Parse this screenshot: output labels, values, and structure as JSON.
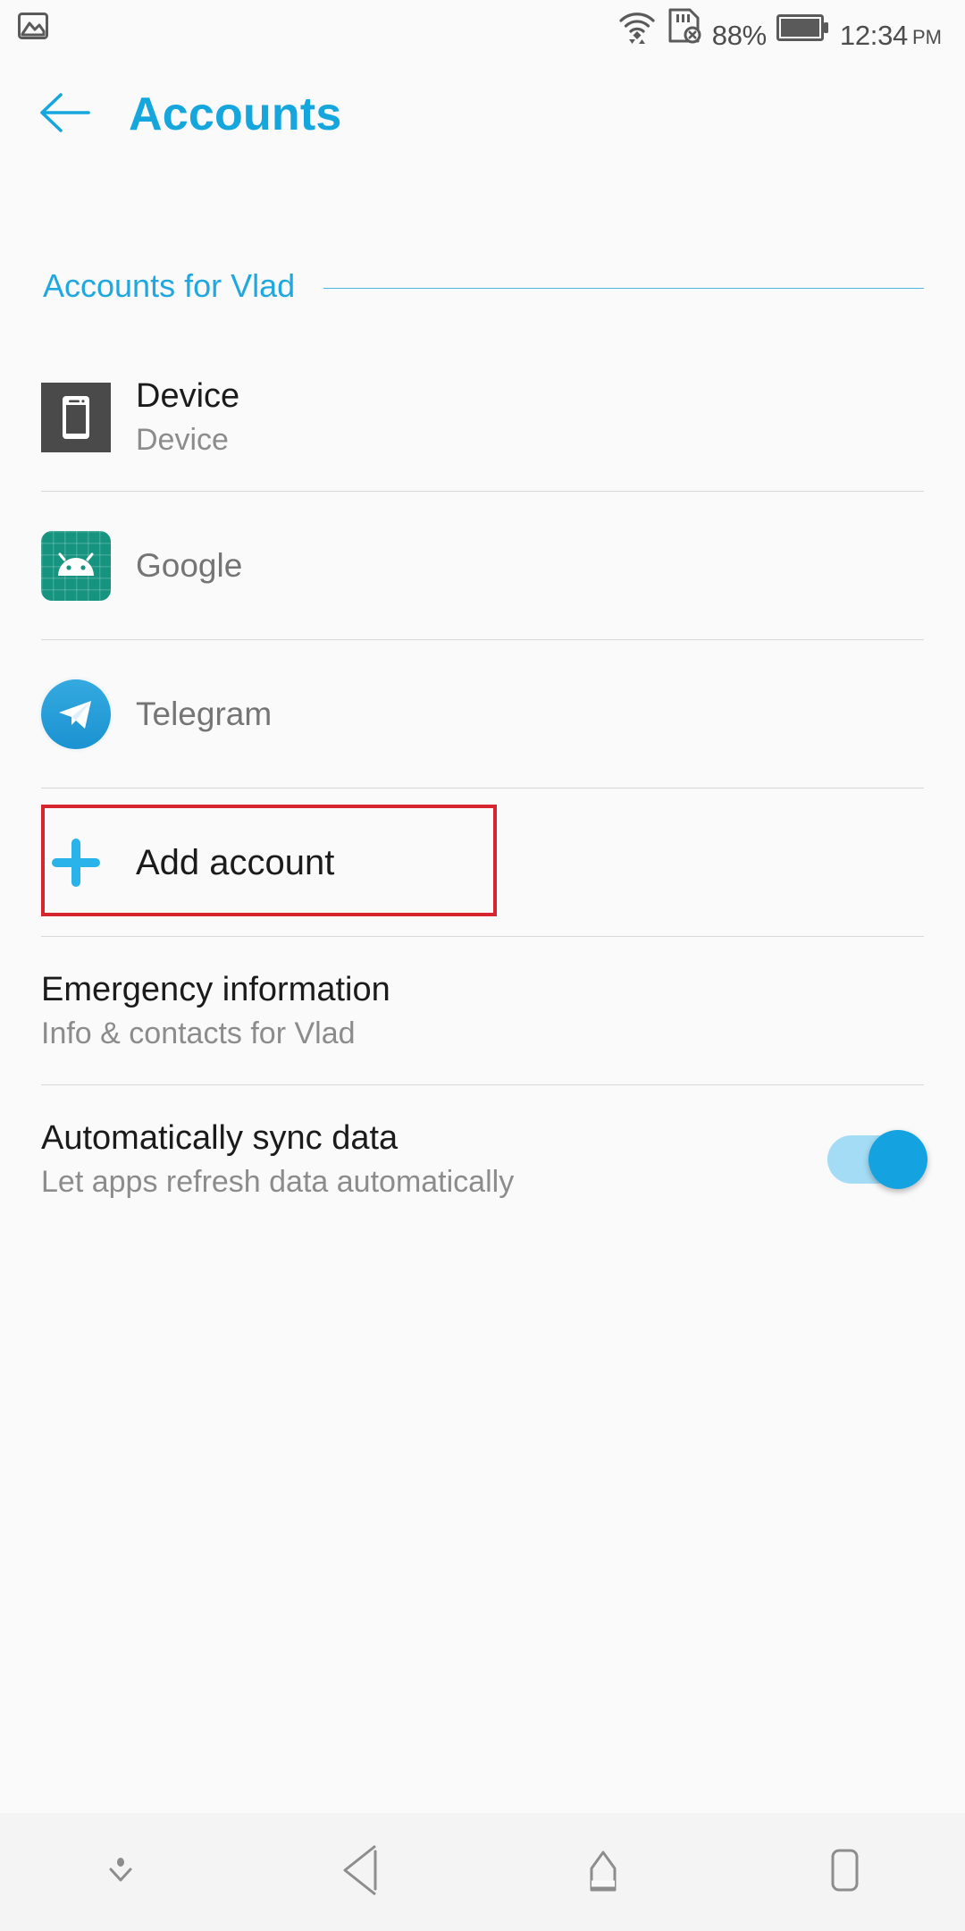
{
  "statusbar": {
    "notification_icon": "image-screenshot-icon",
    "wifi_icon": "wifi-icon",
    "sim_icon": "sim-card-no-service-icon",
    "battery_percent": "88%",
    "battery_icon": "battery-icon",
    "time": "12:34",
    "ampm": "PM"
  },
  "header": {
    "back_icon": "back-arrow-icon",
    "title": "Accounts",
    "accent_color": "#15a6dd"
  },
  "section": {
    "title": "Accounts for Vlad",
    "rule_color": "#4fb7e0"
  },
  "accounts": [
    {
      "icon": "device-phone-icon",
      "title": "Device",
      "subtitle": "Device"
    },
    {
      "icon": "android-google-icon",
      "title": "",
      "subtitle": "Google"
    },
    {
      "icon": "telegram-icon",
      "title": "",
      "subtitle": "Telegram"
    }
  ],
  "add_account": {
    "icon": "plus-icon",
    "label": "Add account",
    "highlight_color": "#d6252f",
    "plus_color": "#29b3ea"
  },
  "settings": [
    {
      "title": "Emergency information",
      "subtitle": "Info & contacts for Vlad"
    },
    {
      "title": "Automatically sync data",
      "subtitle": "Let apps refresh data automatically",
      "toggle": "on",
      "toggle_color": "#14a3e0"
    }
  ],
  "navbar": {
    "hide_icon": "chevron-down-icon",
    "back_icon": "nav-back-triangle-icon",
    "home_icon": "nav-home-icon",
    "recents_icon": "nav-recents-icon"
  }
}
